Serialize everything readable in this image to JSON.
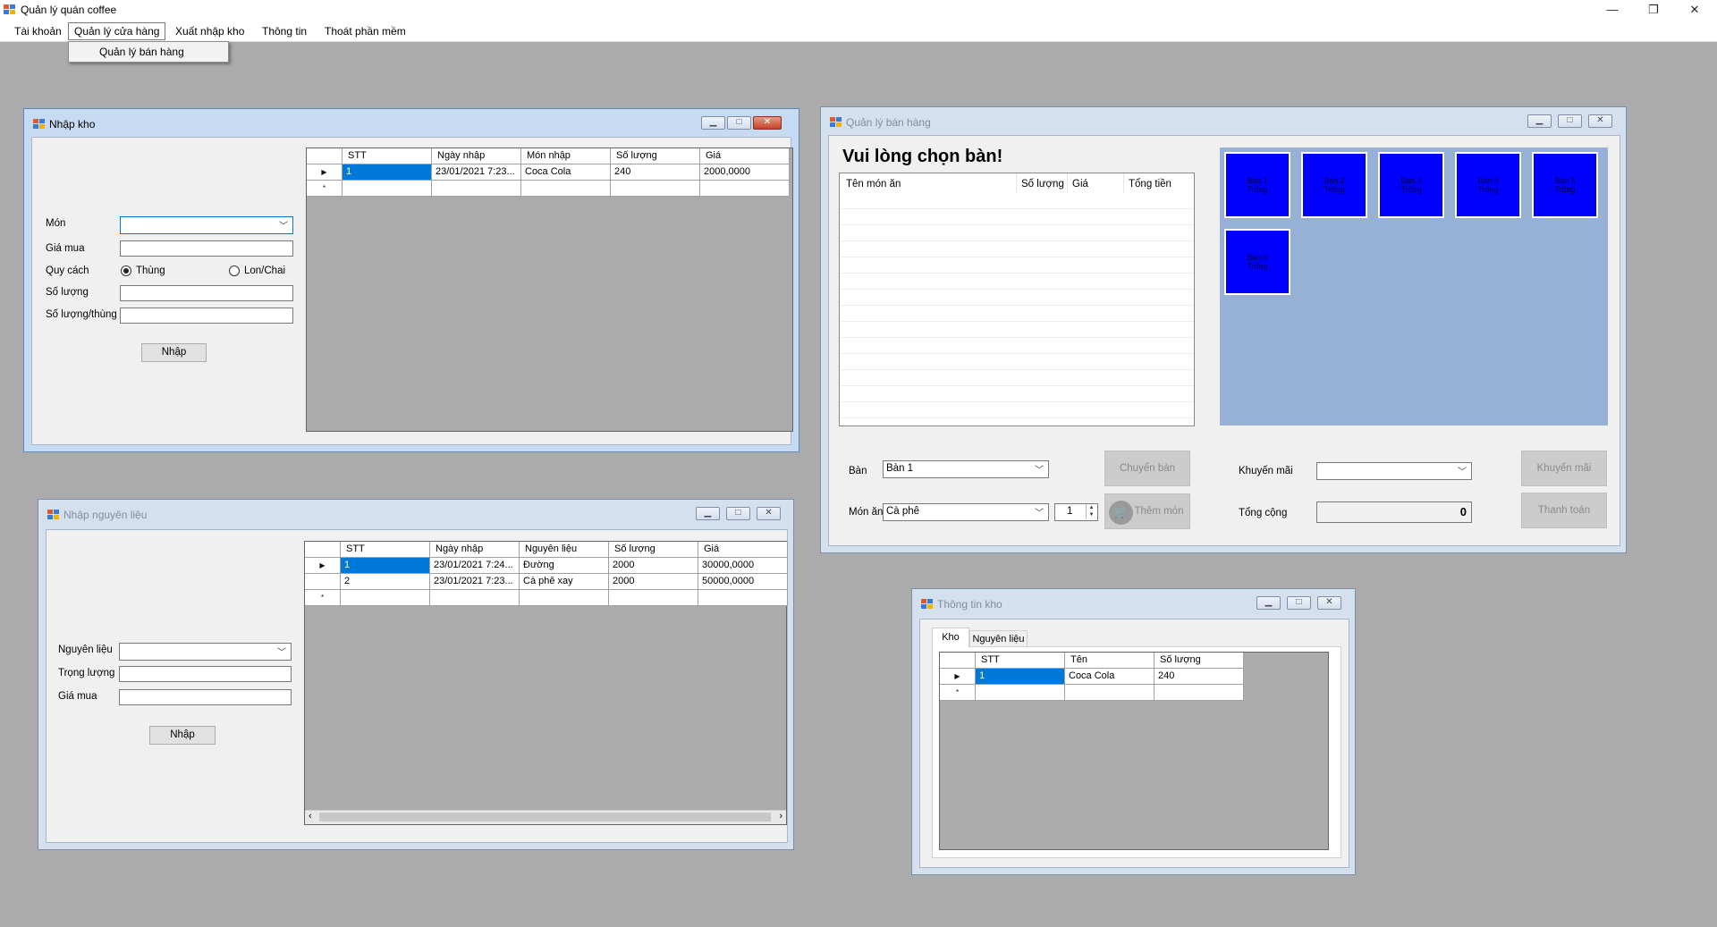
{
  "app": {
    "title": "Quản lý quán coffee",
    "minimize": "—",
    "restore": "❐",
    "close": "✕"
  },
  "menu": {
    "items": [
      "Tài khoản",
      "Quản lý cửa hàng",
      "Xuất nhập kho",
      "Thông tin",
      "Thoát phần mềm"
    ],
    "dropdown_item": "Quản lý bán hàng"
  },
  "nhap_kho": {
    "title": "Nhập kho",
    "labels": {
      "mon": "Món",
      "gia_mua": "Giá mua",
      "quy_cach": "Quy cách",
      "so_luong": "Số lượng",
      "so_luong_thung": "Số lượng/thùng"
    },
    "radio_thung": "Thùng",
    "radio_lon": "Lon/Chai",
    "button": "Nhập",
    "columns": [
      "STT",
      "Ngày nhập",
      "Món nhập",
      "Số lượng",
      "Giá"
    ],
    "rows": [
      [
        "1",
        "23/01/2021 7:23...",
        "Coca Cola",
        "240",
        "2000,0000"
      ]
    ]
  },
  "nhap_nguyen_lieu": {
    "title": "Nhập nguyên liệu",
    "labels": {
      "nguyen_lieu": "Nguyên liệu",
      "trong_luong": "Trọng lượng",
      "gia_mua": "Giá mua"
    },
    "button": "Nhập",
    "columns": [
      "STT",
      "Ngày nhập",
      "Nguyên liệu",
      "Số lượng",
      "Giá"
    ],
    "rows": [
      [
        "1",
        "23/01/2021 7:24...",
        "Đường",
        "2000",
        "30000,0000"
      ],
      [
        "2",
        "23/01/2021 7:23...",
        "Cà phê xay",
        "2000",
        "50000,0000"
      ]
    ]
  },
  "ban_hang": {
    "title": "Quản lý bán hàng",
    "heading": "Vui lòng chọn bàn!",
    "order_columns": [
      "Tên món ăn",
      "Số lượng",
      "Giá",
      "Tổng tiền"
    ],
    "tables": [
      {
        "name": "Bàn 1",
        "status": "Trống"
      },
      {
        "name": "Bàn 2",
        "status": "Trống"
      },
      {
        "name": "Bàn 3",
        "status": "Trống"
      },
      {
        "name": "Bàn 4",
        "status": "Trống"
      },
      {
        "name": "Bàn 5",
        "status": "Trống"
      },
      {
        "name": "Bàn 6",
        "status": "Trống"
      }
    ],
    "labels": {
      "ban": "Bàn",
      "mon_an": "Món ăn",
      "khuyen_mai": "Khuyến mãi",
      "tong_cong": "Tổng cộng"
    },
    "ban_value": "Bàn 1",
    "mon_an_value": "Cà phê",
    "quantity": "1",
    "khuyen_mai_value": "",
    "tong_cong_value": "0",
    "buttons": {
      "chuyen_ban": "Chuyển bàn",
      "them_mon": "Thêm món",
      "khuyen_mai": "Khuyến mãi",
      "thanh_toan": "Thanh toán"
    }
  },
  "thong_tin_kho": {
    "title": "Thông tin kho",
    "tabs": [
      "Kho",
      "Nguyên liệu"
    ],
    "columns": [
      "STT",
      "Tên",
      "Số lượng"
    ],
    "rows": [
      [
        "1",
        "Coca Cola",
        "240"
      ]
    ]
  },
  "colors": {
    "mdi_background": "#ababab",
    "table_free": "#0000ff",
    "selection": "#0078d7"
  }
}
